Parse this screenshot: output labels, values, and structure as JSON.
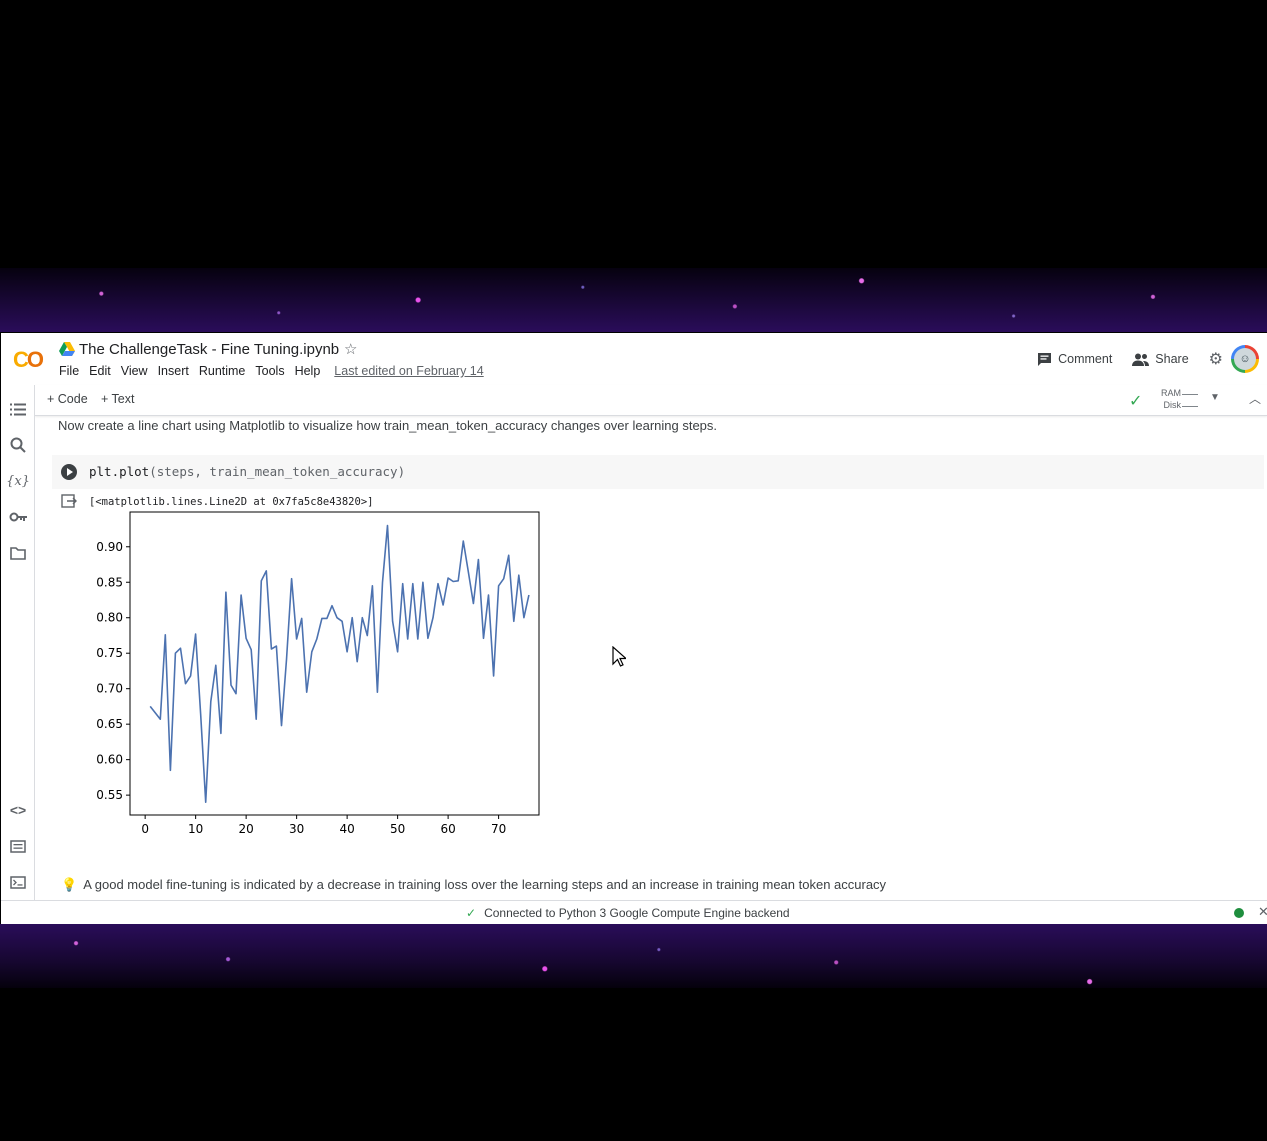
{
  "app": {
    "doc_title": "The ChallengeTask - Fine Tuning.ipynb",
    "menu": [
      "File",
      "Edit",
      "View",
      "Insert",
      "Runtime",
      "Tools",
      "Help"
    ],
    "last_edited": "Last edited on February 14",
    "comment_label": "Comment",
    "share_label": "Share"
  },
  "toolbar": {
    "add_code": "+ Code",
    "add_text": "+ Text",
    "ram_label": "RAM",
    "disk_label": "Disk"
  },
  "sidebar": {
    "icons": [
      "table-of-contents-icon",
      "search-icon",
      "variables-icon",
      "secrets-key-icon",
      "files-folder-icon",
      "code-snippets-icon",
      "command-palette-icon",
      "terminal-icon"
    ]
  },
  "notebook": {
    "intro_text": "Now create a line chart using Matplotlib to visualize how train_mean_token_accuracy changes over learning steps.",
    "code_prefix": "plt.plot",
    "code_args": "(steps, train_mean_token_accuracy)",
    "output_text": "[<matplotlib.lines.Line2D at 0x7fa5c8e43820>]",
    "tip_text": "A good model fine-tuning is indicated by a decrease in training loss over the learning steps and an increase in training mean token accuracy"
  },
  "status": {
    "text": "Connected to Python 3 Google Compute Engine backend"
  },
  "chart_data": {
    "type": "line",
    "xlim": [
      -3,
      78
    ],
    "ylim": [
      0.522,
      0.949
    ],
    "xticks": [
      0,
      10,
      20,
      30,
      40,
      50,
      60,
      70
    ],
    "yticks": [
      0.55,
      0.6,
      0.65,
      0.7,
      0.75,
      0.8,
      0.85,
      0.9
    ],
    "line_color": "#4c72b0",
    "grid": false,
    "series": [
      {
        "x": [
          1,
          2,
          3,
          4,
          5,
          6,
          7,
          8,
          9,
          10,
          11,
          12,
          13,
          14,
          15,
          16,
          17,
          18,
          19,
          20,
          21,
          22,
          23,
          24,
          25,
          26,
          27,
          28,
          29,
          30,
          31,
          32,
          33,
          34,
          35,
          36,
          37,
          38,
          39,
          40,
          41,
          42,
          43,
          44,
          45,
          46,
          47,
          48,
          49,
          50,
          51,
          52,
          53,
          54,
          55,
          56,
          57,
          58,
          59,
          60,
          61,
          62,
          63,
          64,
          65,
          66,
          67,
          68,
          69,
          70,
          71,
          72,
          73,
          74,
          75,
          76
        ],
        "y": [
          0.675,
          0.666,
          0.657,
          0.776,
          0.585,
          0.75,
          0.757,
          0.707,
          0.718,
          0.777,
          0.663,
          0.54,
          0.682,
          0.733,
          0.637,
          0.836,
          0.705,
          0.693,
          0.832,
          0.771,
          0.755,
          0.657,
          0.852,
          0.866,
          0.756,
          0.76,
          0.648,
          0.741,
          0.855,
          0.77,
          0.799,
          0.695,
          0.752,
          0.77,
          0.799,
          0.799,
          0.817,
          0.8,
          0.795,
          0.752,
          0.8,
          0.738,
          0.8,
          0.775,
          0.845,
          0.695,
          0.85,
          0.93,
          0.795,
          0.752,
          0.848,
          0.77,
          0.848,
          0.77,
          0.85,
          0.771,
          0.8,
          0.848,
          0.818,
          0.856,
          0.851,
          0.852,
          0.908,
          0.865,
          0.82,
          0.882,
          0.771,
          0.832,
          0.718,
          0.845,
          0.855,
          0.888,
          0.795,
          0.86,
          0.8,
          0.832
        ]
      }
    ]
  }
}
